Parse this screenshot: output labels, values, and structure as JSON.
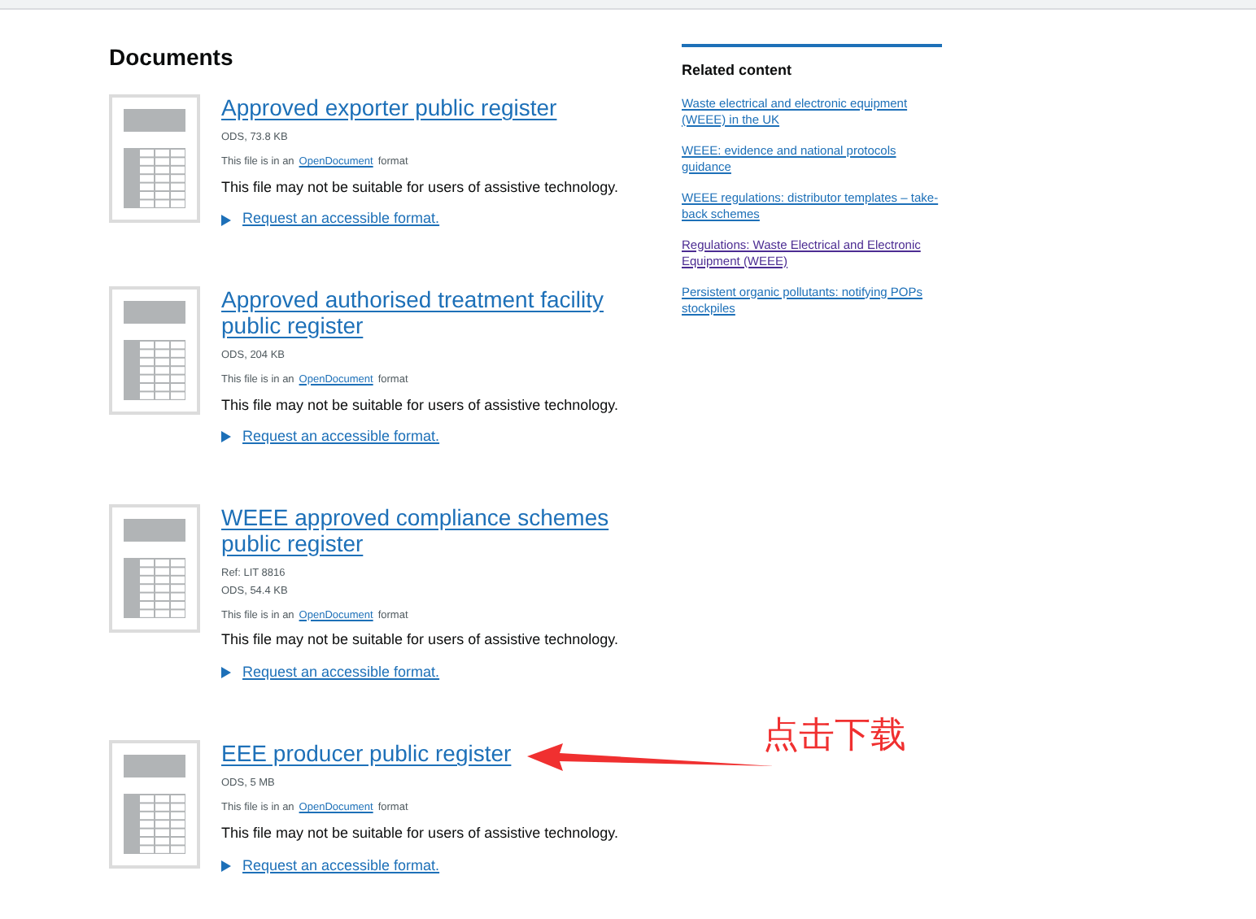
{
  "documents_heading": "Documents",
  "documents": [
    {
      "title": "Approved exporter public register",
      "meta": [
        "ODS, 73.8 KB"
      ],
      "format_prefix": "This file is in an",
      "format_link": "OpenDocument",
      "format_suffix": "format",
      "notice": "This file may not be suitable for users of assistive technology.",
      "request_link": "Request an accessible format."
    },
    {
      "title": "Approved authorised treatment facility public register",
      "meta": [
        "ODS, 204 KB"
      ],
      "format_prefix": "This file is in an",
      "format_link": "OpenDocument",
      "format_suffix": "format",
      "notice": "This file may not be suitable for users of assistive technology.",
      "request_link": "Request an accessible format."
    },
    {
      "title": "WEEE approved compliance schemes public register",
      "meta": [
        "Ref: LIT 8816",
        "ODS, 54.4 KB"
      ],
      "format_prefix": "This file is in an",
      "format_link": "OpenDocument",
      "format_suffix": "format",
      "notice": "This file may not be suitable for users of assistive technology.",
      "request_link": "Request an accessible format."
    },
    {
      "title": "EEE producer public register",
      "meta": [
        "ODS, 5 MB"
      ],
      "format_prefix": "This file is in an",
      "format_link": "OpenDocument",
      "format_suffix": "format",
      "notice": "This file may not be suitable for users of assistive technology.",
      "request_link": "Request an accessible format."
    }
  ],
  "related": {
    "heading": "Related content",
    "links": [
      {
        "label": "Waste electrical and electronic equipment (WEEE) in the UK",
        "visited": false
      },
      {
        "label": "WEEE: evidence and national protocols guidance",
        "visited": false
      },
      {
        "label": "WEEE regulations: distributor templates – take-back schemes",
        "visited": false
      },
      {
        "label": "Regulations: Waste Electrical and Electronic Equipment (WEEE)",
        "visited": true
      },
      {
        "label": "Persistent organic pollutants: notifying POPs stockpiles",
        "visited": false
      }
    ]
  },
  "annotation": {
    "text": "点击下载"
  }
}
